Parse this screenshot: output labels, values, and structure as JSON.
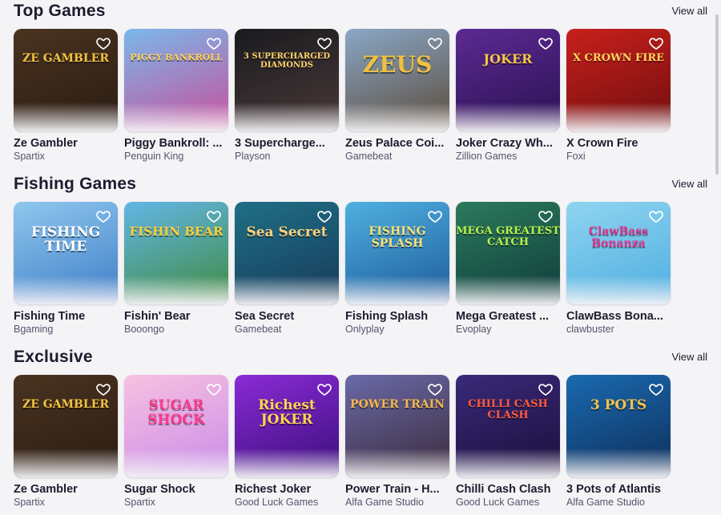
{
  "view_all_label": "View all",
  "sections": [
    {
      "title": "Top Games",
      "games": [
        {
          "name": "Ze Gambler",
          "provider": "Spartix",
          "art": "ZE GAMBLER",
          "bg": "#4a3320",
          "bg2": "#2a1c12",
          "fg": "#f2c340",
          "art_size": "14px"
        },
        {
          "name": "Piggy Bankroll: ...",
          "provider": "Penguin King",
          "art": "PIGGY BANKROLL",
          "bg": "#7ab8ea",
          "bg2": "#c84f9b",
          "fg": "#ffd34d",
          "art_size": "11px"
        },
        {
          "name": "3 Supercharge...",
          "provider": "Playson",
          "art": "3 SUPERCHARGED DIAMONDS",
          "bg": "#1a1a1e",
          "bg2": "#4a3a3a",
          "fg": "#ffd36a",
          "art_size": "10px"
        },
        {
          "name": "Zeus Palace Coi...",
          "provider": "Gamebeat",
          "art": "ZEUS",
          "bg": "#8aa7c7",
          "bg2": "#5b4b3a",
          "fg": "#f1c040",
          "art_size": "28px"
        },
        {
          "name": "Joker Crazy Wh...",
          "provider": "Zillion Games",
          "art": "JOKER",
          "bg": "#5b2a93",
          "bg2": "#2a1050",
          "fg": "#f5c842",
          "art_size": "16px"
        },
        {
          "name": "X Crown Fire",
          "provider": "Foxi",
          "art": "X CROWN FIRE",
          "bg": "#c8201c",
          "bg2": "#6e0e0e",
          "fg": "#ffd65a",
          "art_size": "13px"
        }
      ]
    },
    {
      "title": "Fishing Games",
      "games": [
        {
          "name": "Fishing Time",
          "provider": "Bgaming",
          "art": "FISHING TIME",
          "bg": "#8fc7ee",
          "bg2": "#3f7ec7",
          "fg": "#ffffff",
          "art_size": "17px"
        },
        {
          "name": "Fishin' Bear",
          "provider": "Booongo",
          "art": "FISHIN BEAR",
          "bg": "#63b6e6",
          "bg2": "#3f8a3f",
          "fg": "#ffce3a",
          "art_size": "15px"
        },
        {
          "name": "Sea Secret",
          "provider": "Gamebeat",
          "art": "Sea Secret",
          "bg": "#1f6f86",
          "bg2": "#173a5a",
          "fg": "#ffd07a",
          "art_size": "17px"
        },
        {
          "name": "Fishing Splash",
          "provider": "Onlyplay",
          "art": "FISHING SPLASH",
          "bg": "#4fb0e0",
          "bg2": "#1d5a9a",
          "fg": "#ffe070",
          "art_size": "14px"
        },
        {
          "name": "Mega Greatest ...",
          "provider": "Evoplay",
          "art": "MEGA GREATEST CATCH",
          "bg": "#2c7a5c",
          "bg2": "#0f3b3b",
          "fg": "#b6f04a",
          "art_size": "13px"
        },
        {
          "name": "ClawBass Bona...",
          "provider": "clawbuster",
          "art": "ClawBass Bonanza",
          "bg": "#8fd4f0",
          "bg2": "#4eaee0",
          "fg": "#e0318c",
          "art_size": "14px"
        }
      ]
    },
    {
      "title": "Exclusive",
      "games": [
        {
          "name": "Ze Gambler",
          "provider": "Spartix",
          "art": "ZE GAMBLER",
          "bg": "#4a3320",
          "bg2": "#2a1c12",
          "fg": "#f2c340",
          "art_size": "14px"
        },
        {
          "name": "Sugar Shock",
          "provider": "Spartix",
          "art": "SUGAR SHOCK",
          "bg": "#f7c1e1",
          "bg2": "#c98ce8",
          "fg": "#ff3b8f",
          "art_size": "17px"
        },
        {
          "name": "Richest Joker",
          "provider": "Good Luck Games",
          "art": "Richest JOKER",
          "bg": "#8a2bd6",
          "bg2": "#3a0e7a",
          "fg": "#ffd54a",
          "art_size": "17px"
        },
        {
          "name": "Power Train - H...",
          "provider": "Alfa Game Studio",
          "art": "POWER TRAIN",
          "bg": "#6a6aa8",
          "bg2": "#3a2a3a",
          "fg": "#f3b84a",
          "art_size": "14px"
        },
        {
          "name": "Chilli Cash Clash",
          "provider": "Good Luck Games",
          "art": "CHILLI CASH CLASH",
          "bg": "#3a2a7a",
          "bg2": "#1a0e3a",
          "fg": "#ff5a3a",
          "art_size": "13px"
        },
        {
          "name": "3 Pots of Atlantis",
          "provider": "Alfa Game Studio",
          "art": "3 POTS",
          "bg": "#1a6ab0",
          "bg2": "#0e2e5a",
          "fg": "#f2c24a",
          "art_size": "17px"
        }
      ]
    }
  ]
}
